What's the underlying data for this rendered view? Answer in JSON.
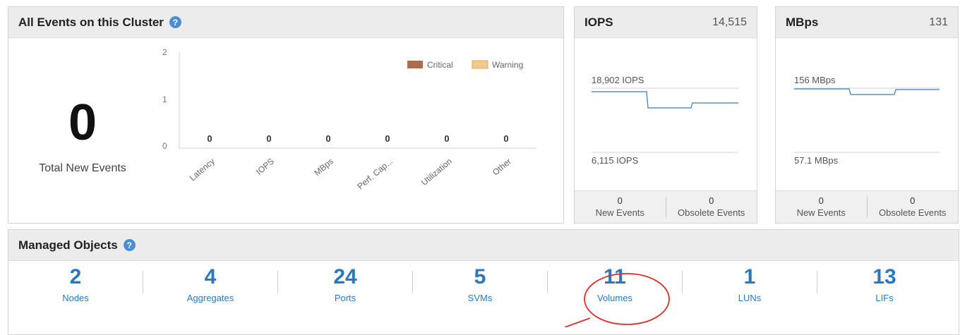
{
  "events": {
    "title": "All Events on this Cluster",
    "total_count": "0",
    "total_label": "Total New Events",
    "legend": [
      {
        "label": "Critical",
        "color": "#a8704e"
      },
      {
        "label": "Warning",
        "color": "#f1c98c"
      }
    ],
    "y_ticks": [
      "2",
      "1",
      "0"
    ],
    "categories": [
      {
        "label": "Latency",
        "value": "0"
      },
      {
        "label": "IOPS",
        "value": "0"
      },
      {
        "label": "MBps",
        "value": "0"
      },
      {
        "label": "Perf. Cap...",
        "value": "0"
      },
      {
        "label": "Utilization",
        "value": "0"
      },
      {
        "label": "Other",
        "value": "0"
      }
    ]
  },
  "iops": {
    "title": "IOPS",
    "value": "14,515",
    "upper_label": "18,902 IOPS",
    "lower_label": "6,115 IOPS",
    "new_events_count": "0",
    "new_events_label": "New Events",
    "obsolete_events_count": "0",
    "obsolete_events_label": "Obsolete Events"
  },
  "mbps": {
    "title": "MBps",
    "value": "131",
    "upper_label": "156 MBps",
    "lower_label": "57.1 MBps",
    "new_events_count": "0",
    "new_events_label": "New Events",
    "obsolete_events_count": "0",
    "obsolete_events_label": "Obsolete Events"
  },
  "managed": {
    "title": "Managed Objects",
    "items": [
      {
        "count": "2",
        "label": "Nodes"
      },
      {
        "count": "4",
        "label": "Aggregates"
      },
      {
        "count": "24",
        "label": "Ports"
      },
      {
        "count": "5",
        "label": "SVMs"
      },
      {
        "count": "11",
        "label": "Volumes"
      },
      {
        "count": "1",
        "label": "LUNs"
      },
      {
        "count": "13",
        "label": "LIFs"
      }
    ]
  },
  "colors": {
    "accent": "#2b79bd",
    "sparkline": "#5a93c2",
    "annotation": "#d9302c"
  },
  "icons": {
    "help": "help-circle-icon"
  }
}
